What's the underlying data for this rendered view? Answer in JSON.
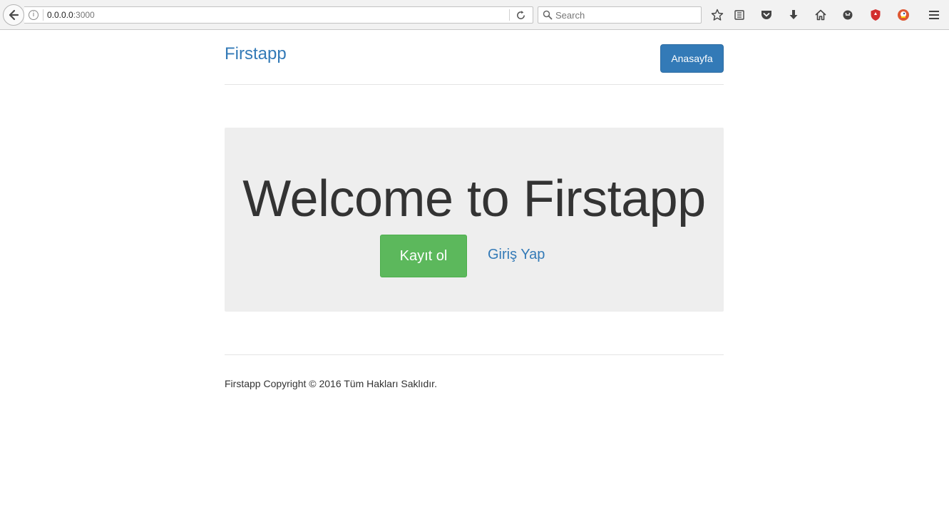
{
  "browser": {
    "url_host": "0.0.0.0",
    "url_port": ":3000",
    "search_placeholder": "Search",
    "toolbar_icons": [
      "bookmark-star-icon",
      "reading-list-icon",
      "pocket-icon",
      "downloads-icon",
      "home-icon",
      "chat-icon",
      "shield-icon",
      "duckduckgo-icon",
      "menu-icon"
    ]
  },
  "header": {
    "brand": "Firstapp",
    "home_button": "Anasayfa"
  },
  "jumbotron": {
    "title": "Welcome to Firstapp",
    "signup_button": "Kayıt ol",
    "login_link": "Giriş Yap"
  },
  "footer": {
    "text": "Firstapp Copyright © 2016 Tüm Hakları Saklıdır."
  },
  "colors": {
    "primary": "#337ab7",
    "success": "#5cb85c",
    "jumbotron_bg": "#eeeeee"
  }
}
